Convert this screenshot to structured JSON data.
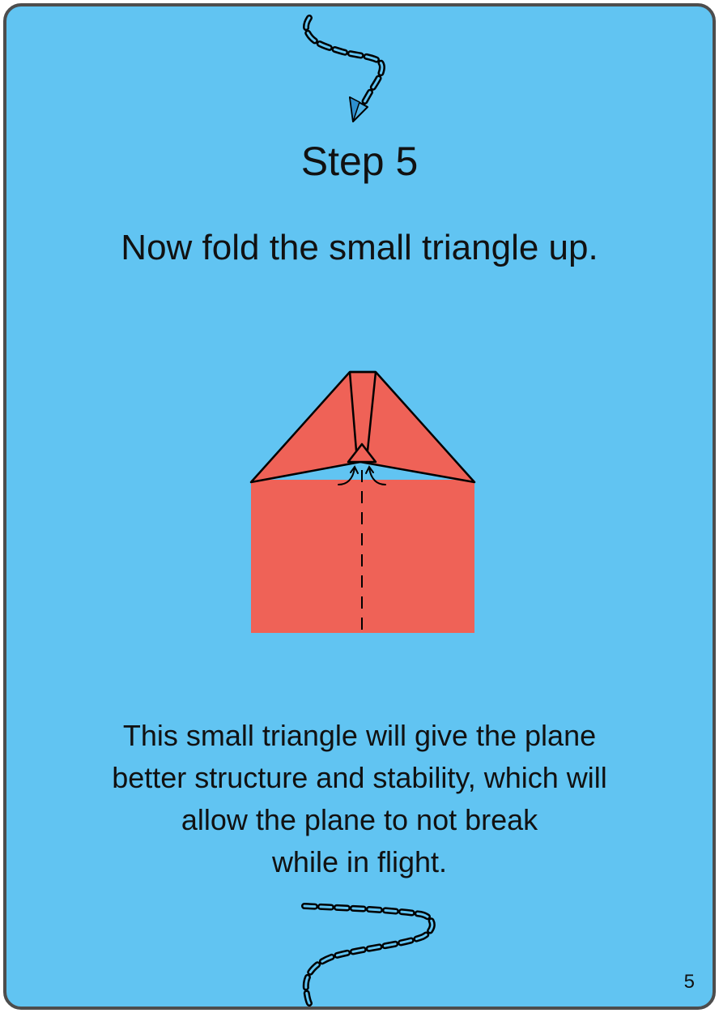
{
  "step_title": "Step 5",
  "instruction": "Now fold the small triangle up.",
  "note_lines": [
    "This small triangle will give the plane",
    "better structure and stability, which will",
    "allow the plane to not break",
    "while in flight."
  ],
  "page_number": "5",
  "icons": {
    "flight_path_top": "dashed-flight-path-icon",
    "paper_plane": "paper-plane-icon",
    "flight_path_bottom": "dashed-flight-path-icon",
    "fold_arrows": "curved-arrow-icon"
  },
  "colors": {
    "background": "#61c4f2",
    "border": "#4d4d4d",
    "paper": "#ef6257",
    "line": "#000000",
    "plane": "#4fb4e8"
  }
}
